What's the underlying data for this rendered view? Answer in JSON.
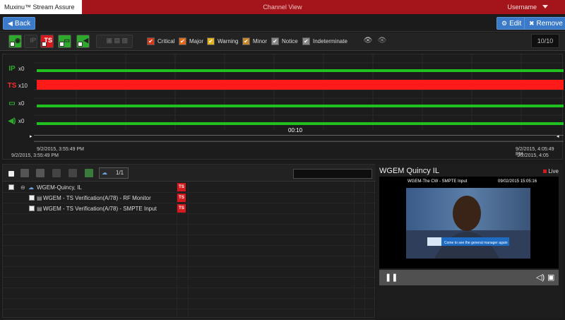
{
  "titlebar": {
    "app_title": "Muxinu™ Stream Assure",
    "view_title": "Channel View",
    "username": "Username"
  },
  "actions": {
    "back_label": "Back",
    "edit_label": "Edit",
    "remove_label": "Remove"
  },
  "filters": {
    "type_toggles": [
      {
        "name": "ip",
        "label": "IP",
        "color": "#2ea92e",
        "active": true
      },
      {
        "name": "ts",
        "label": "TS",
        "color": "#d6191c",
        "active": true
      },
      {
        "name": "video",
        "label": "",
        "color": "#2ea92e",
        "active": true
      },
      {
        "name": "audio",
        "label": "",
        "color": "#2ea92e",
        "active": true
      }
    ],
    "severities": [
      {
        "label": "Critical",
        "color": "#d43a1a"
      },
      {
        "label": "Major",
        "color": "#e06a1c"
      },
      {
        "label": "Warning",
        "color": "#e1b21a"
      },
      {
        "label": "Minor",
        "color": "#c8862c"
      },
      {
        "label": "Notice",
        "color": "#888888"
      },
      {
        "label": "Indeterminate",
        "color": "#888888"
      }
    ],
    "page_count": "10/10"
  },
  "timeline": {
    "rows": [
      {
        "icon": "IP",
        "count": "x0",
        "color": "#20c020"
      },
      {
        "icon": "TS",
        "count": "x10",
        "color": "#ff1a1a"
      },
      {
        "icon": "▭",
        "count": "x0",
        "color": "#20c020"
      },
      {
        "icon": "◀)",
        "count": "x0",
        "color": "#20c020"
      }
    ],
    "cursor_time": "00:10",
    "range_start_top": "9/2/2015, 3:55:49 PM",
    "range_end_top": "9/2/2015, 4:05:49 PM",
    "range_start_bottom": "9/2/2015, 3:55:49 PM",
    "range_end_bottom": "9/2/2015, 4:05"
  },
  "tree": {
    "page": "1/1",
    "search_placeholder": "",
    "items": [
      {
        "label": "WGEM-Quincy, IL",
        "badge": "TS"
      },
      {
        "label": "WGEM - TS Verification(A/78) - RF Monitor",
        "badge": "TS"
      },
      {
        "label": "WGEM - TS Verification(A/78) - SMPTE Input",
        "badge": "TS"
      }
    ]
  },
  "player": {
    "title": "WGEM Quincy IL",
    "live_label": "Live",
    "caption_left": "WGEM-The CW - SMPTE Input",
    "caption_right": "09/02/2015 15:05:16",
    "lower_third": "Come to see the general manager again"
  }
}
